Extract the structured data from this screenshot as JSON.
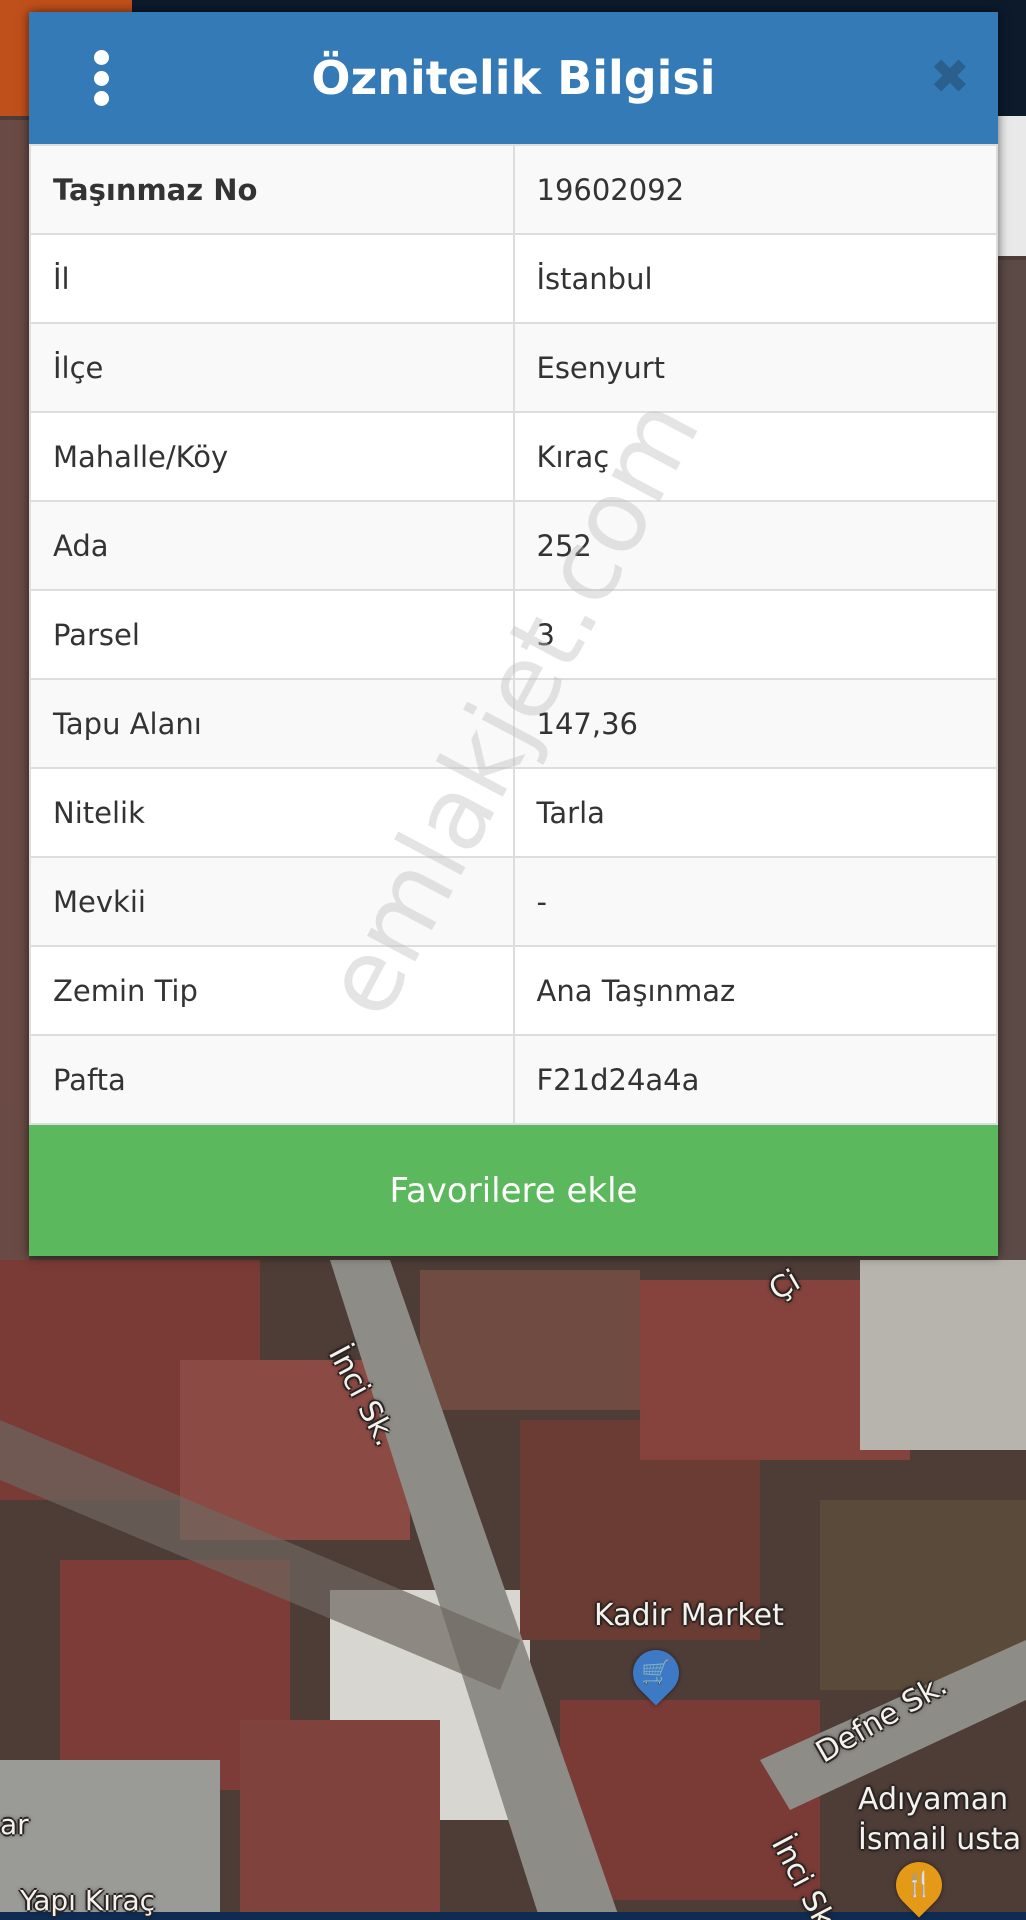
{
  "modal": {
    "title": "Öznitelik Bilgisi",
    "close_glyph": "✖",
    "rows": [
      {
        "key": "Taşınmaz No",
        "value": "19602092"
      },
      {
        "key": "İl",
        "value": "İstanbul"
      },
      {
        "key": "İlçe",
        "value": "Esenyurt"
      },
      {
        "key": "Mahalle/Köy",
        "value": "Kıraç"
      },
      {
        "key": "Ada",
        "value": "252"
      },
      {
        "key": "Parsel",
        "value": "3"
      },
      {
        "key": "Tapu Alanı",
        "value": "147,36"
      },
      {
        "key": "Nitelik",
        "value": "Tarla"
      },
      {
        "key": "Mevkii",
        "value": "-"
      },
      {
        "key": "Zemin Tip",
        "value": "Ana Taşınmaz"
      },
      {
        "key": "Pafta",
        "value": "F21d24a4a"
      }
    ],
    "favorite_button": "Favorilere ekle"
  },
  "watermark": "emlakjet.com",
  "map": {
    "labels": {
      "inci_sk_top": "İnci Sk.",
      "kadir_market": "Kadir Market",
      "defne_sk": "Defne Sk.",
      "adiyaman_1": "Adıyaman",
      "adiyaman_2": "İsmail usta",
      "inci_sk_bottom": "İnci Sk.",
      "yapi_kirac": "Yapı Kıraç",
      "ar": "ar",
      "cut_top": "Çi"
    },
    "icons": {
      "shop_pin": "shopping-cart-icon",
      "food_pin": "restaurant-icon"
    }
  },
  "colors": {
    "header": "#337ab7",
    "favorite": "#5cb85c"
  }
}
